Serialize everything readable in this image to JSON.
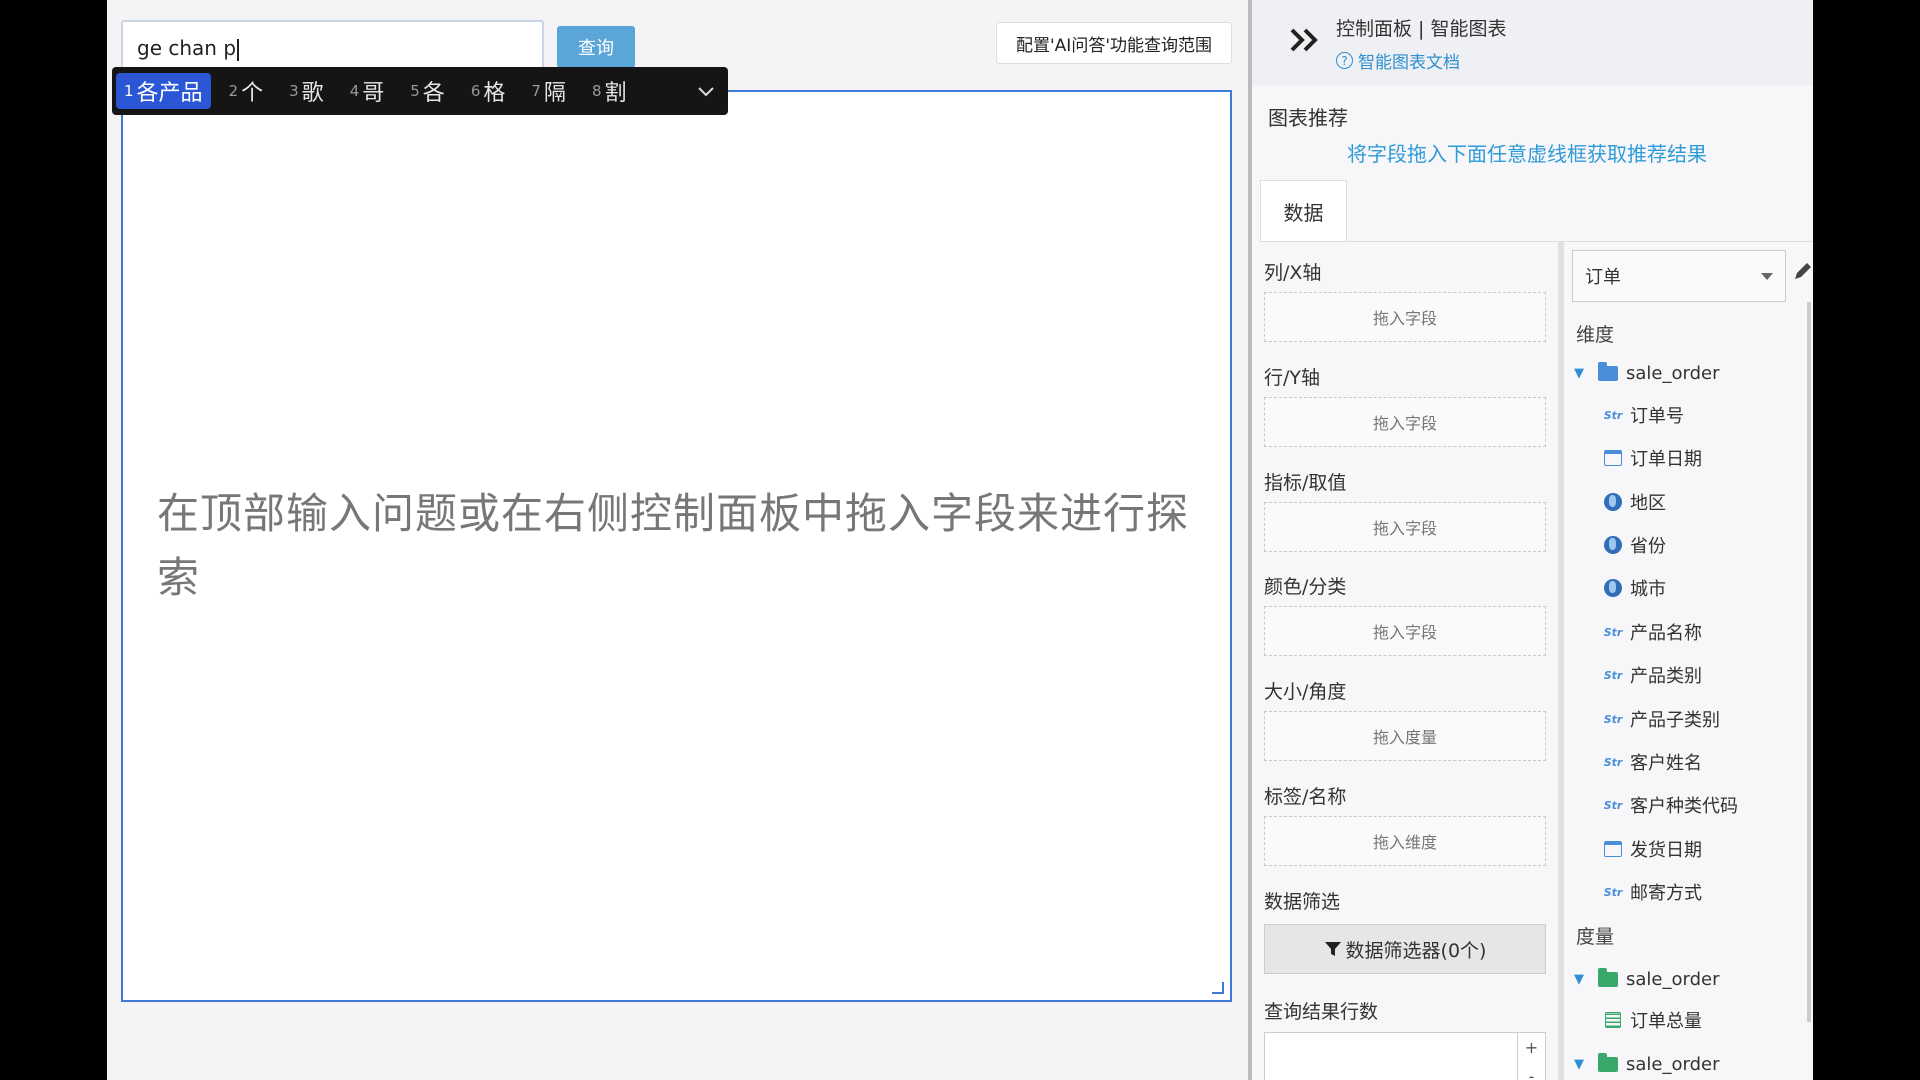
{
  "top": {
    "query_value": "ge chan p",
    "query_button": "查询",
    "config_button": "配置'AI问答'功能查询范围"
  },
  "ime": {
    "candidates": [
      {
        "num": "1",
        "text": "各产品"
      },
      {
        "num": "2",
        "text": "个"
      },
      {
        "num": "3",
        "text": "歌"
      },
      {
        "num": "4",
        "text": "哥"
      },
      {
        "num": "5",
        "text": "各"
      },
      {
        "num": "6",
        "text": "格"
      },
      {
        "num": "7",
        "text": "隔"
      },
      {
        "num": "8",
        "text": "割"
      }
    ],
    "expand_icon": "chevron-down-icon"
  },
  "canvas": {
    "hint": "在顶部输入问题或在右侧控制面板中拖入字段来进行探索"
  },
  "panel": {
    "title": "控制面板 | 智能图表",
    "doc_link": "智能图表文档",
    "rec_title": "图表推荐",
    "rec_hint": "将字段拖入下面任意虚线框获取推荐结果",
    "tab_data": "数据",
    "drops": [
      {
        "label": "列/X轴",
        "placeholder": "拖入字段"
      },
      {
        "label": "行/Y轴",
        "placeholder": "拖入字段"
      },
      {
        "label": "指标/取值",
        "placeholder": "拖入字段"
      },
      {
        "label": "颜色/分类",
        "placeholder": "拖入字段"
      },
      {
        "label": "大小/角度",
        "placeholder": "拖入度量"
      },
      {
        "label": "标签/名称",
        "placeholder": "拖入维度"
      }
    ],
    "filter_label": "数据筛选",
    "filter_button": "数据筛选器(0个)",
    "rows_label": "查询结果行数",
    "stepper_plus": "+",
    "stepper_minus": "-"
  },
  "fields": {
    "datasource": "订单",
    "dimension_label": "维度",
    "dimension_folder": "sale_order",
    "dimensions": [
      {
        "type": "str",
        "name": "订单号"
      },
      {
        "type": "date",
        "name": "订单日期"
      },
      {
        "type": "geo",
        "name": "地区"
      },
      {
        "type": "geo",
        "name": "省份"
      },
      {
        "type": "geo",
        "name": "城市"
      },
      {
        "type": "str",
        "name": "产品名称"
      },
      {
        "type": "str",
        "name": "产品类别"
      },
      {
        "type": "str",
        "name": "产品子类别"
      },
      {
        "type": "str",
        "name": "客户姓名"
      },
      {
        "type": "str",
        "name": "客户种类代码"
      },
      {
        "type": "date",
        "name": "发货日期"
      },
      {
        "type": "str",
        "name": "邮寄方式"
      }
    ],
    "measure_label": "度量",
    "measure_folder_1": "sale_order",
    "measures": [
      {
        "type": "measure",
        "name": "订单总量"
      }
    ],
    "measure_folder_2": "sale_order",
    "str_badge": "Str"
  }
}
